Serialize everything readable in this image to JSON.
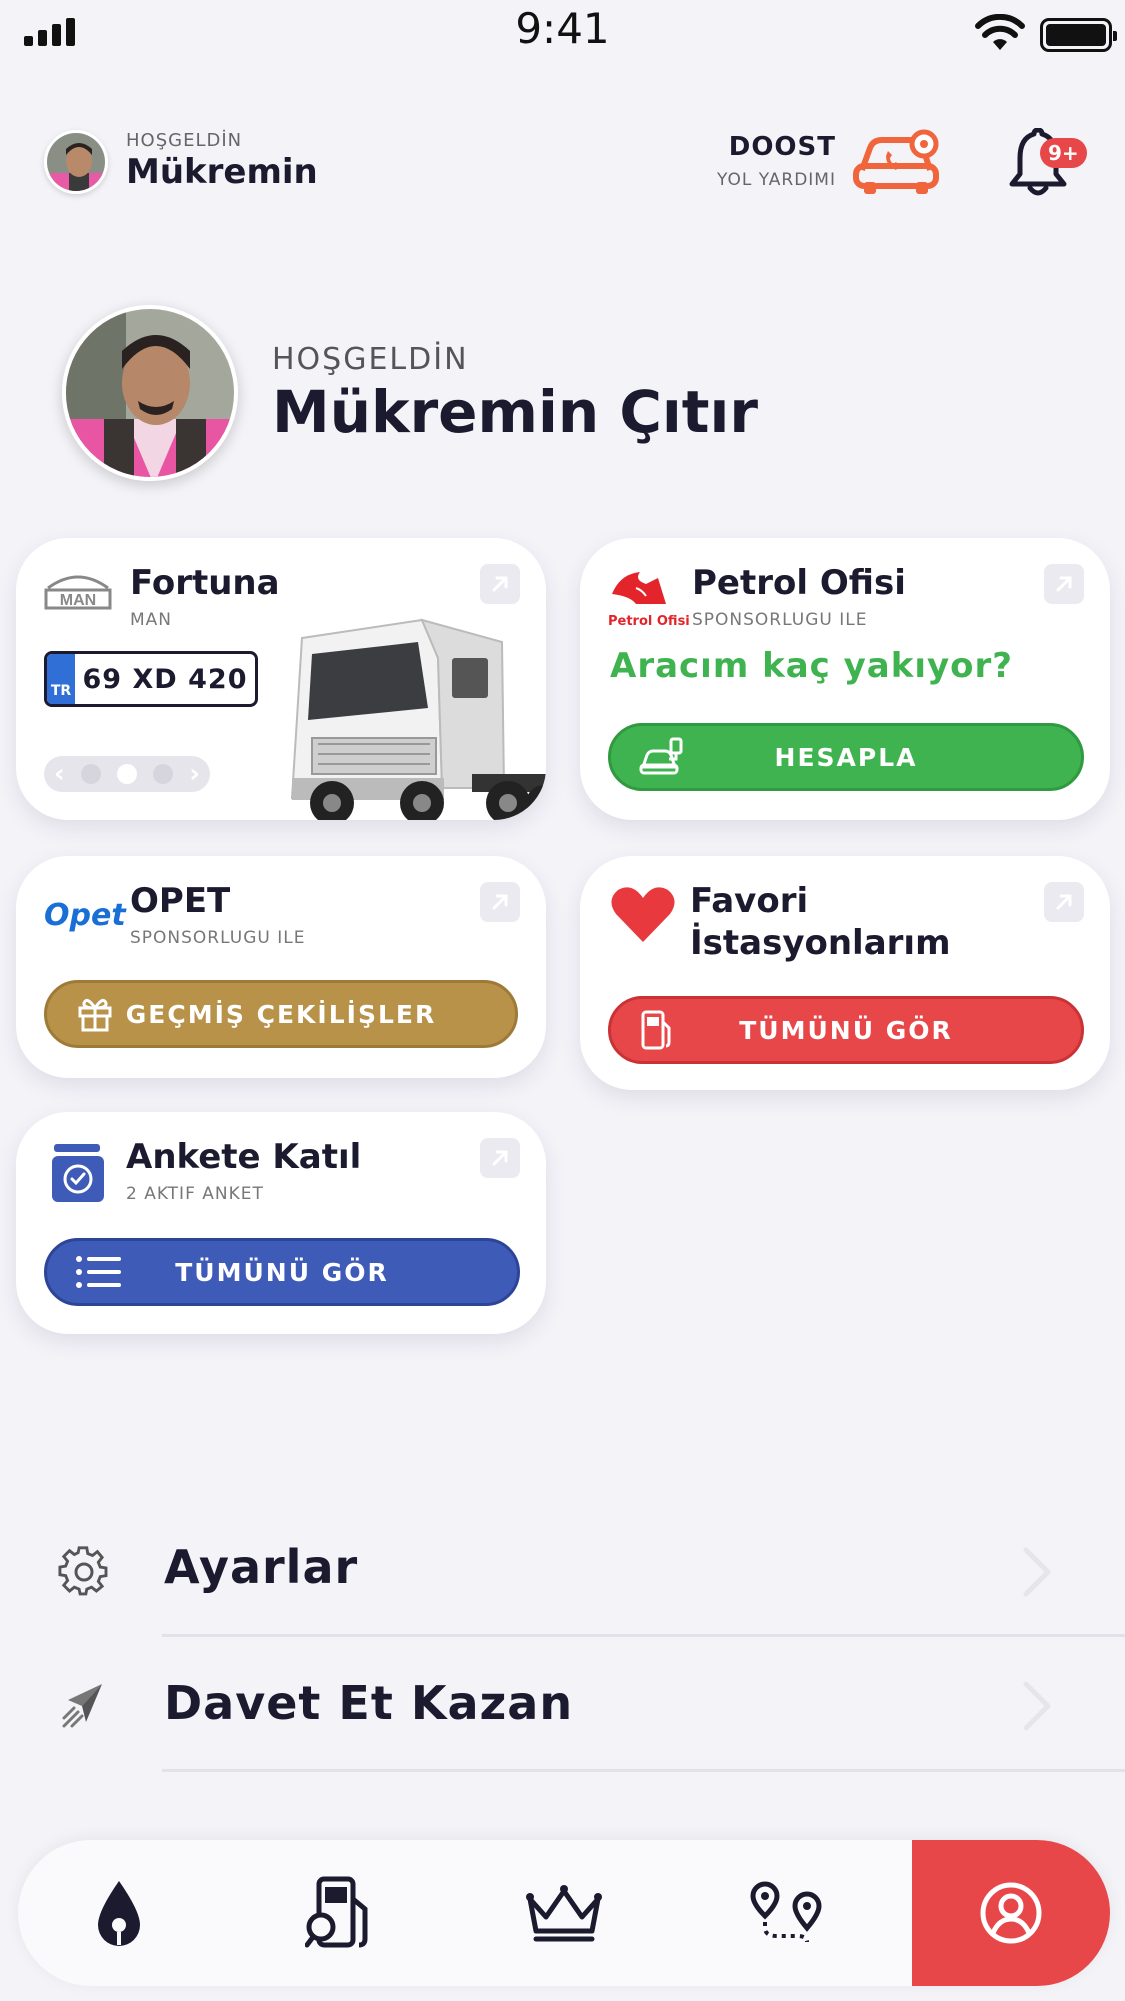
{
  "status_bar": {
    "time": "9:41"
  },
  "header": {
    "greeting": "HOŞGELDİN",
    "user_first_name": "Mükremin",
    "doost_title": "DOOST",
    "doost_subtitle": "YOL YARDIMI",
    "notification_badge": "9+"
  },
  "profile": {
    "greeting": "HOŞGELDİN",
    "full_name": "Mükremin Çıtır"
  },
  "vehicle_card": {
    "name": "Fortuna",
    "brand": "MAN",
    "plate_country": "TR",
    "plate_number": "69 XD 420",
    "pager_index": 2,
    "pager_total": 3
  },
  "petrol_ofisi_card": {
    "logo_text": "Petrol Ofisi",
    "title": "Petrol Ofisi",
    "subtitle": "SPONSORLUGU ILE",
    "question": "Aracım kaç yakıyor?",
    "button_label": "HESAPLA",
    "button_color": "#3fb34f"
  },
  "opet_card": {
    "logo_text": "Opet",
    "title": "OPET",
    "subtitle": "SPONSORLUGU ILE",
    "button_label": "GEÇMİŞ ÇEKİLİŞLER",
    "button_color": "#b9924a"
  },
  "favorites_card": {
    "title_line1": "Favori",
    "title_line2": "İstasyonlarım",
    "button_label": "TÜMÜNÜ GÖR",
    "button_color": "#e8474a"
  },
  "survey_card": {
    "title": "Ankete Katıl",
    "subtitle": "2 AKTIF ANKET",
    "button_label": "TÜMÜNÜ GÖR",
    "button_color": "#3f5bb8"
  },
  "menu": [
    {
      "label": "Ayarlar",
      "icon": "gear-icon"
    },
    {
      "label": "Davet Et Kazan",
      "icon": "paper-plane-icon"
    }
  ],
  "tabbar": {
    "tabs": [
      "fuel-drop-icon",
      "fuel-pump-search-icon",
      "crown-icon",
      "route-pins-icon",
      "user-circle-icon"
    ],
    "active_index": 4,
    "active_color": "#e8474a"
  }
}
